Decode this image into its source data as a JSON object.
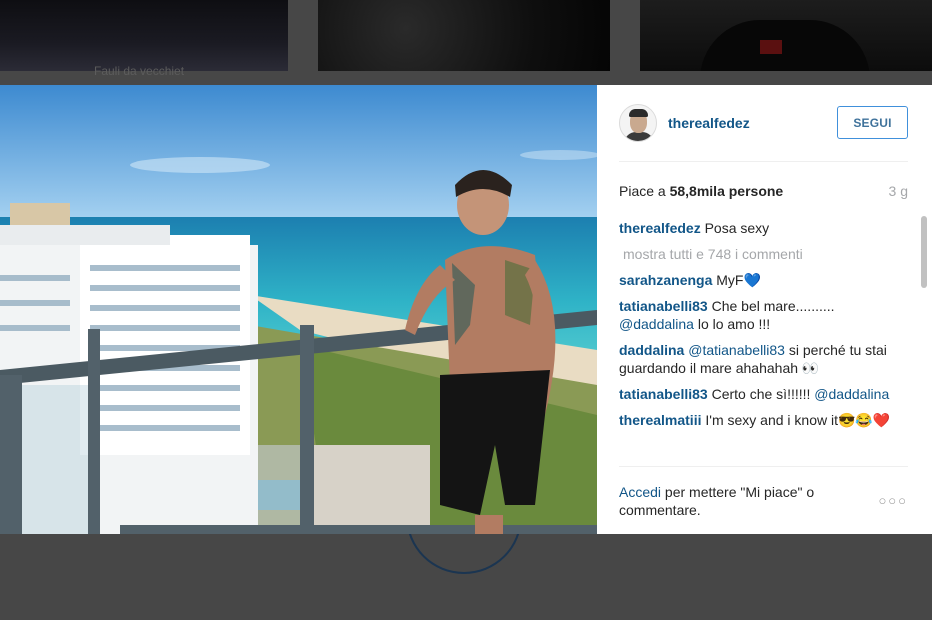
{
  "background": {
    "caption": "Fauli da vecchiet"
  },
  "post": {
    "username": "therealfedez",
    "follow_label": "SEGUI",
    "likes_prefix": "Piace a ",
    "likes_count": "58,8mila",
    "likes_suffix": " persone",
    "timestamp": "3 g",
    "caption_user": "therealfedez",
    "caption_text": "Posa sexy",
    "show_all_comments": "mostra tutti e 748 i commenti",
    "comments": [
      {
        "user": "sarahzanenga",
        "text": "MyF💙"
      },
      {
        "user": "tatianabelli83",
        "text": "Che bel mare.......... ",
        "mention": "@daddalina",
        "text2": " lo lo amo !!!"
      },
      {
        "user": "daddalina",
        "mention": "@tatianabelli83",
        "text": " si perché tu stai guardando il mare ahahahah 👀"
      },
      {
        "user": "tatianabelli83",
        "text": "Certo che sì!!!!!! ",
        "mention": "@daddalina"
      },
      {
        "user": "therealmatiii",
        "text": "I'm sexy and i know it😎😂❤️"
      }
    ],
    "footer_login": "Accedi",
    "footer_text": " per mettere \"Mi piace\" o commentare.",
    "more_options": "○○○"
  },
  "colors": {
    "link_blue": "#125688",
    "follow_border": "#4090db",
    "overlay": "#474747"
  }
}
